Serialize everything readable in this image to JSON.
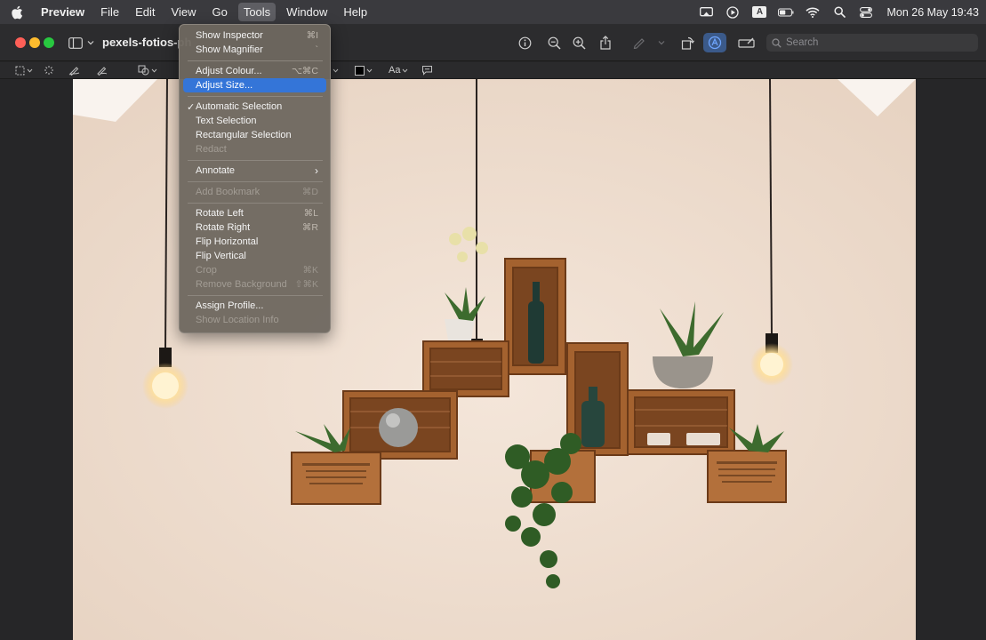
{
  "menubar": {
    "items": [
      "Preview",
      "File",
      "Edit",
      "View",
      "Go",
      "Tools",
      "Window",
      "Help"
    ],
    "active": "Tools",
    "keyboard_indicator": "A",
    "datetime": "Mon 26 May  19:43"
  },
  "window": {
    "title": "pexels-fotios-ph",
    "search_placeholder": "Search",
    "font_button": "Aa"
  },
  "tools_menu": {
    "items": [
      {
        "label": "Show Inspector",
        "shortcut": "⌘I"
      },
      {
        "label": "Show Magnifier",
        "shortcut": "`"
      },
      {
        "label": "Adjust Colour...",
        "shortcut": "⌥⌘C"
      },
      {
        "label": "Adjust Size...",
        "shortcut": ""
      },
      {
        "label": "Automatic Selection",
        "shortcut": ""
      },
      {
        "label": "Text Selection",
        "shortcut": ""
      },
      {
        "label": "Rectangular Selection",
        "shortcut": ""
      },
      {
        "label": "Redact",
        "shortcut": ""
      },
      {
        "label": "Annotate",
        "shortcut": "›"
      },
      {
        "label": "Add Bookmark",
        "shortcut": "⌘D"
      },
      {
        "label": "Rotate Left",
        "shortcut": "⌘L"
      },
      {
        "label": "Rotate Right",
        "shortcut": "⌘R"
      },
      {
        "label": "Flip Horizontal",
        "shortcut": ""
      },
      {
        "label": "Flip Vertical",
        "shortcut": ""
      },
      {
        "label": "Crop",
        "shortcut": "⌘K"
      },
      {
        "label": "Remove Background",
        "shortcut": "⇧⌘K"
      },
      {
        "label": "Assign Profile...",
        "shortcut": ""
      },
      {
        "label": "Show Location Info",
        "shortcut": ""
      }
    ],
    "checkmark": "✓"
  },
  "colors": {
    "menubar_bg": "#3a3a3e",
    "menu_bg": "#6e6860",
    "highlight": "#3475d8",
    "wall": "#efe0d3",
    "wood": "#9a5a2c"
  }
}
